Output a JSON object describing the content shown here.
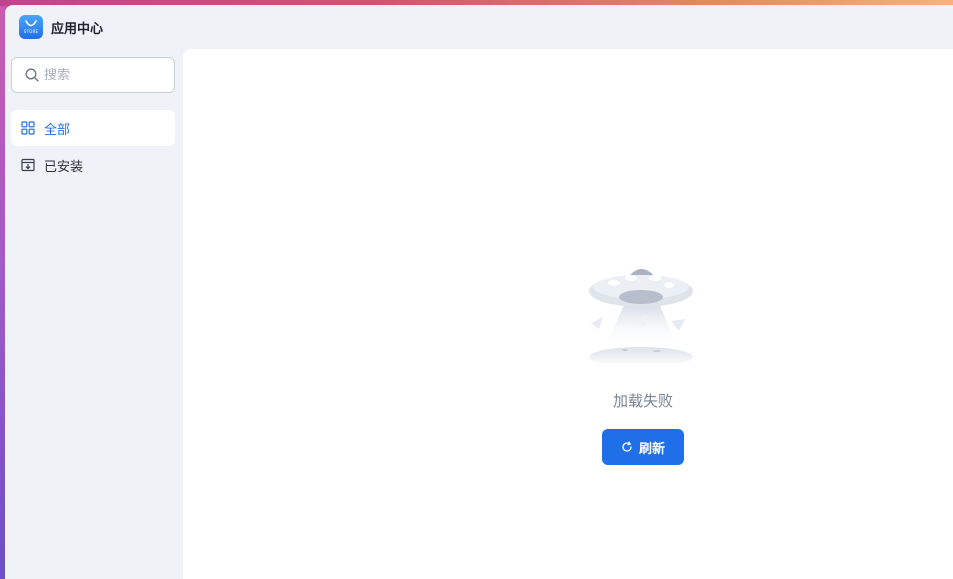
{
  "app": {
    "title": "应用中心",
    "icon_name": "store-bag-icon",
    "icon_text": "STORE",
    "accent_color": "#1f6fe8"
  },
  "sidebar": {
    "search": {
      "placeholder": "搜索",
      "value": ""
    },
    "items": [
      {
        "label": "全部",
        "icon": "grid-icon",
        "active": true
      },
      {
        "label": "已安装",
        "icon": "installed-box-icon",
        "active": false
      }
    ]
  },
  "main": {
    "empty_state": {
      "illustration": "ufo-illustration",
      "message": "加载失败",
      "button_label": "刷新",
      "button_icon": "refresh-icon"
    }
  }
}
